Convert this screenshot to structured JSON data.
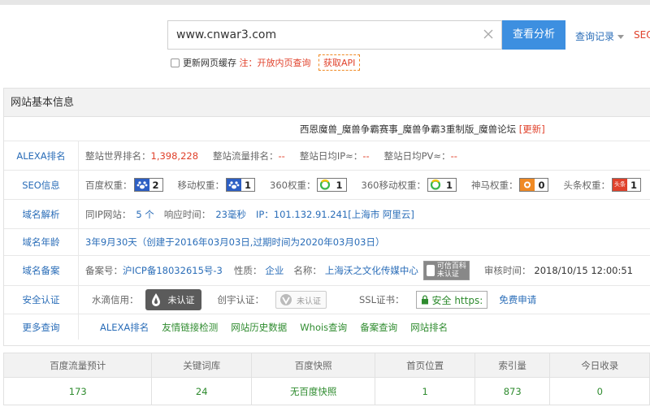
{
  "search": {
    "value": "www.cnwar3.com",
    "button": "查看分析",
    "history": "查询记录",
    "seo": "SEO"
  },
  "options": {
    "refresh_cache": "更新网页缓存",
    "note": "注：开放内页查询",
    "api": "获取API"
  },
  "panel": {
    "title": "网站基本信息",
    "site_title": "西恩魔兽_魔兽争霸赛事_魔兽争霸3重制版_魔兽论坛",
    "update": "[更新]"
  },
  "alexa": {
    "label": "ALEXA排名",
    "world_rank_label": "整站世界排名：",
    "world_rank": "1,398,228",
    "traffic_rank_label": "整站流量排名：",
    "traffic_rank": "--",
    "daily_ip_label": "整站日均IP≈：",
    "daily_ip": "--",
    "daily_pv_label": "整站日均PV≈：",
    "daily_pv": "--"
  },
  "seo_info": {
    "label": "SEO信息",
    "baidu_label": "百度权重：",
    "baidu": "2",
    "mobile_label": "移动权重：",
    "mobile": "1",
    "s360_label": "360权重：",
    "s360": "1",
    "s360m_label": "360移动权重：",
    "s360m": "1",
    "shenma_label": "神马权重：",
    "shenma": "0",
    "toutiao_label": "头条权重：",
    "toutiao": "1",
    "toutiao_icon_text": "头条"
  },
  "dns": {
    "label": "域名解析",
    "same_ip_label": "同IP网站：",
    "same_ip": "5 个",
    "resp_label": "响应时间：",
    "resp": "23毫秒",
    "ip_label": "IP：",
    "ip": "101.132.91.241[上海市 阿里云]"
  },
  "age": {
    "label": "域名年龄",
    "text": "3年9月30天（创建于2016年03月03日,过期时间为2020年03月03日）"
  },
  "icp": {
    "label": "域名备案",
    "no_label": "备案号：",
    "no": "沪ICP备18032615号-3",
    "nature_label": "性质：",
    "nature": "企业",
    "name_label": "名称：",
    "name": "上海沃之文化传媒中心",
    "kxbk_top": "可信百科",
    "kxbk_bottom": "未认证",
    "audit_label": "审核时间：",
    "audit": "2018/10/15 12:00:51"
  },
  "security": {
    "label": "安全认证",
    "shuidi_label": "水滴信用：",
    "shuidi": "未认证",
    "chuangyu_label": "创宇认证：",
    "chuangyu": "未认证",
    "ssl_label": "SSL证书：",
    "ssl": "安全 https:",
    "free": "免费申请"
  },
  "more": {
    "label": "更多查询",
    "links": [
      "ALEXA排名",
      "友情链接检测",
      "网站历史数据",
      "Whois查询",
      "备案查询",
      "网站排名"
    ]
  },
  "stats": {
    "headers": [
      "百度流量预计",
      "关键词库",
      "百度快照",
      "首页位置",
      "索引量",
      "今日收录"
    ],
    "values": [
      "173",
      "24",
      "无百度快照",
      "1",
      "873",
      "0"
    ]
  }
}
